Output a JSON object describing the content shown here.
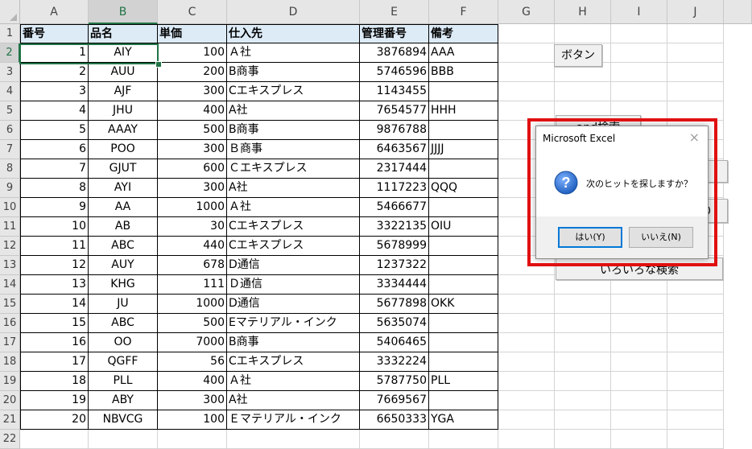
{
  "columns": [
    "A",
    "B",
    "C",
    "D",
    "E",
    "F",
    "G",
    "H",
    "I",
    "J"
  ],
  "selected_column": "B",
  "selected_row": "2",
  "rows": [
    "1",
    "2",
    "3",
    "4",
    "5",
    "6",
    "7",
    "8",
    "9",
    "10",
    "11",
    "12",
    "13",
    "14",
    "15",
    "16",
    "17",
    "18",
    "19",
    "20",
    "21",
    "22"
  ],
  "headers": [
    "番号",
    "品名",
    "単価",
    "仕入先",
    "管理番号",
    "備考"
  ],
  "records": [
    [
      "1",
      "AIY",
      "100",
      "Ａ社",
      "3876894",
      "AAA"
    ],
    [
      "2",
      "AUU",
      "200",
      "B商事",
      "5746596",
      "BBB"
    ],
    [
      "3",
      "AJF",
      "300",
      "Cエキスプレス",
      "1143455",
      ""
    ],
    [
      "4",
      "JHU",
      "400",
      "A社",
      "7654577",
      "HHH"
    ],
    [
      "5",
      "AAAY",
      "500",
      "B商事",
      "9876788",
      ""
    ],
    [
      "6",
      "POO",
      "300",
      "Ｂ商事",
      "6463567",
      "JJJJ"
    ],
    [
      "7",
      "GJUT",
      "600",
      "Ｃエキスプレス",
      "2317444",
      ""
    ],
    [
      "8",
      "AYI",
      "300",
      "A社",
      "1117223",
      "QQQ"
    ],
    [
      "9",
      "AA",
      "1000",
      "Ａ社",
      "5466677",
      ""
    ],
    [
      "10",
      "AB",
      "30",
      "Cエキスプレス",
      "3322135",
      "OIU"
    ],
    [
      "11",
      "ABC",
      "440",
      "Cエキスプレス",
      "5678999",
      ""
    ],
    [
      "12",
      "AUY",
      "678",
      "D通信",
      "1237322",
      ""
    ],
    [
      "13",
      "KHG",
      "111",
      "Ｄ通信",
      "3334444",
      ""
    ],
    [
      "14",
      "JU",
      "1000",
      "D通信",
      "5677898",
      "OKK"
    ],
    [
      "15",
      "ABC",
      "500",
      "Eマテリアル・インク",
      "5635074",
      ""
    ],
    [
      "16",
      "OO",
      "7000",
      "B商事",
      "5406465",
      ""
    ],
    [
      "17",
      "QGFF",
      "56",
      "Cエキスプレス",
      "3332224",
      ""
    ],
    [
      "18",
      "PLL",
      "400",
      "Ａ社",
      "5787750",
      "PLL"
    ],
    [
      "19",
      "ABY",
      "300",
      "A社",
      "7669567",
      ""
    ],
    [
      "20",
      "NBVCG",
      "100",
      "Ｅマテリアル・インク",
      "6650333",
      "YGA"
    ]
  ],
  "sheet_buttons": {
    "button1": "ボタン",
    "button2": "and検索",
    "button3": "",
    "button4": "り",
    "button5": "いろいろな検索"
  },
  "dialog": {
    "title": "Microsoft Excel",
    "close_glyph": "×",
    "message": "次のヒットを探しますか？",
    "yes_label": "はい(Y)",
    "no_label": "いいえ(N)"
  },
  "colors": {
    "header_fill": "#ddebf7",
    "selection_green": "#217346",
    "highlight_red": "#e01010",
    "question_icon_blue": "#1f5fbf"
  }
}
